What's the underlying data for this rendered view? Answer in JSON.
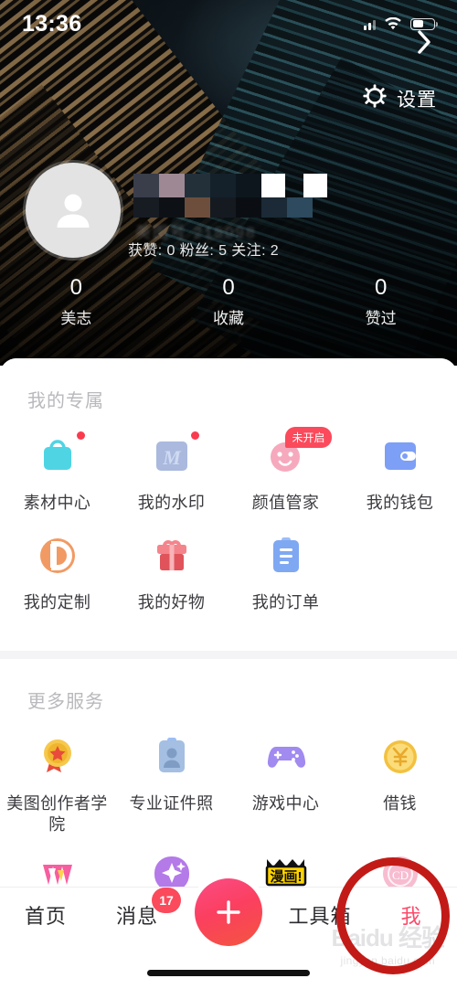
{
  "status_bar": {
    "time": "13:36",
    "icons": [
      "signal-icon",
      "wifi-icon",
      "battery-icon"
    ]
  },
  "header": {
    "settings_label": "设置",
    "settings_icon": "gear-icon",
    "avatar_icon": "person-placeholder-icon",
    "username_masked": "▮▮▮▮▮▮",
    "user_id_blurred": "美图号 215098",
    "stats_line": "获赞: 0  粉丝: 5  关注: 2",
    "chevron_icon": "chevron-right-icon",
    "counters": [
      {
        "num": "0",
        "label": "美志"
      },
      {
        "num": "0",
        "label": "收藏"
      },
      {
        "num": "0",
        "label": "赞过"
      }
    ]
  },
  "exclusive": {
    "title": "我的专属",
    "items": [
      {
        "label": "素材中心",
        "icon": "shopping-bag-icon",
        "badge_dot": true
      },
      {
        "label": "我的水印",
        "icon": "watermark-m-icon",
        "badge_dot": true
      },
      {
        "label": "颜值管家",
        "icon": "face-score-icon",
        "badge_text": "未开启"
      },
      {
        "label": "我的钱包",
        "icon": "wallet-icon"
      },
      {
        "label": "我的定制",
        "icon": "custom-d-icon"
      },
      {
        "label": "我的好物",
        "icon": "gift-icon"
      },
      {
        "label": "我的订单",
        "icon": "clipboard-order-icon"
      }
    ]
  },
  "more_services": {
    "title": "更多服务",
    "items": [
      {
        "label": "美图创作者学院",
        "icon": "medal-icon"
      },
      {
        "label": "专业证件照",
        "icon": "id-photo-icon"
      },
      {
        "label": "游戏中心",
        "icon": "gamepad-icon"
      },
      {
        "label": "借钱",
        "icon": "yen-coin-icon"
      }
    ],
    "partial_items": [
      {
        "icon": "pink-brush-icon"
      },
      {
        "icon": "purple-sparkle-icon"
      },
      {
        "icon": "manga-icon"
      },
      {
        "icon": "pink-circle-icon"
      }
    ]
  },
  "tabbar": {
    "items": [
      {
        "label": "首页",
        "active": false
      },
      {
        "label": "消息",
        "active": false,
        "badge": "17"
      },
      {
        "label": "我",
        "active": true
      }
    ],
    "toolbox_label": "工具箱",
    "fab_icon": "plus-icon"
  },
  "watermark": {
    "main": "Baidu 经验",
    "sub": "jingyan.baidu.com"
  },
  "colors": {
    "accent_pink": "#fb4a6a",
    "badge_red": "#fb4a5b",
    "annotation_red": "#c21b17",
    "title_gray": "#b9b9bd"
  }
}
